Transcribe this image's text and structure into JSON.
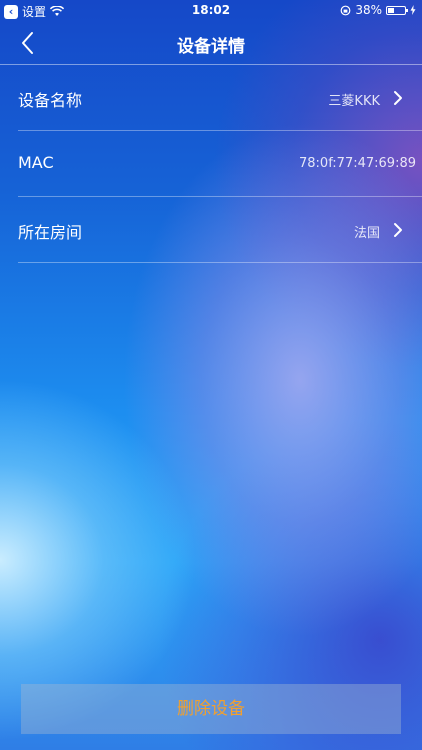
{
  "status_bar": {
    "back_app_label": "设置",
    "time": "18:02",
    "battery": "38%",
    "battery_level": 0.38
  },
  "nav": {
    "title": "设备详情",
    "back_icon": "chevron-left-icon"
  },
  "rows": [
    {
      "label": "设备名称",
      "value": "三菱KKK",
      "has_chevron": true
    },
    {
      "label": "MAC",
      "value": "78:0f:77:47:69:89",
      "has_chevron": false
    },
    {
      "label": "所在房间",
      "value": "法国",
      "has_chevron": true
    }
  ],
  "actions": {
    "delete_label": "删除设备"
  },
  "colors": {
    "delete_text": "#f0a030",
    "background_top": "#1548c8",
    "background_bottom": "#2f7ee6"
  }
}
